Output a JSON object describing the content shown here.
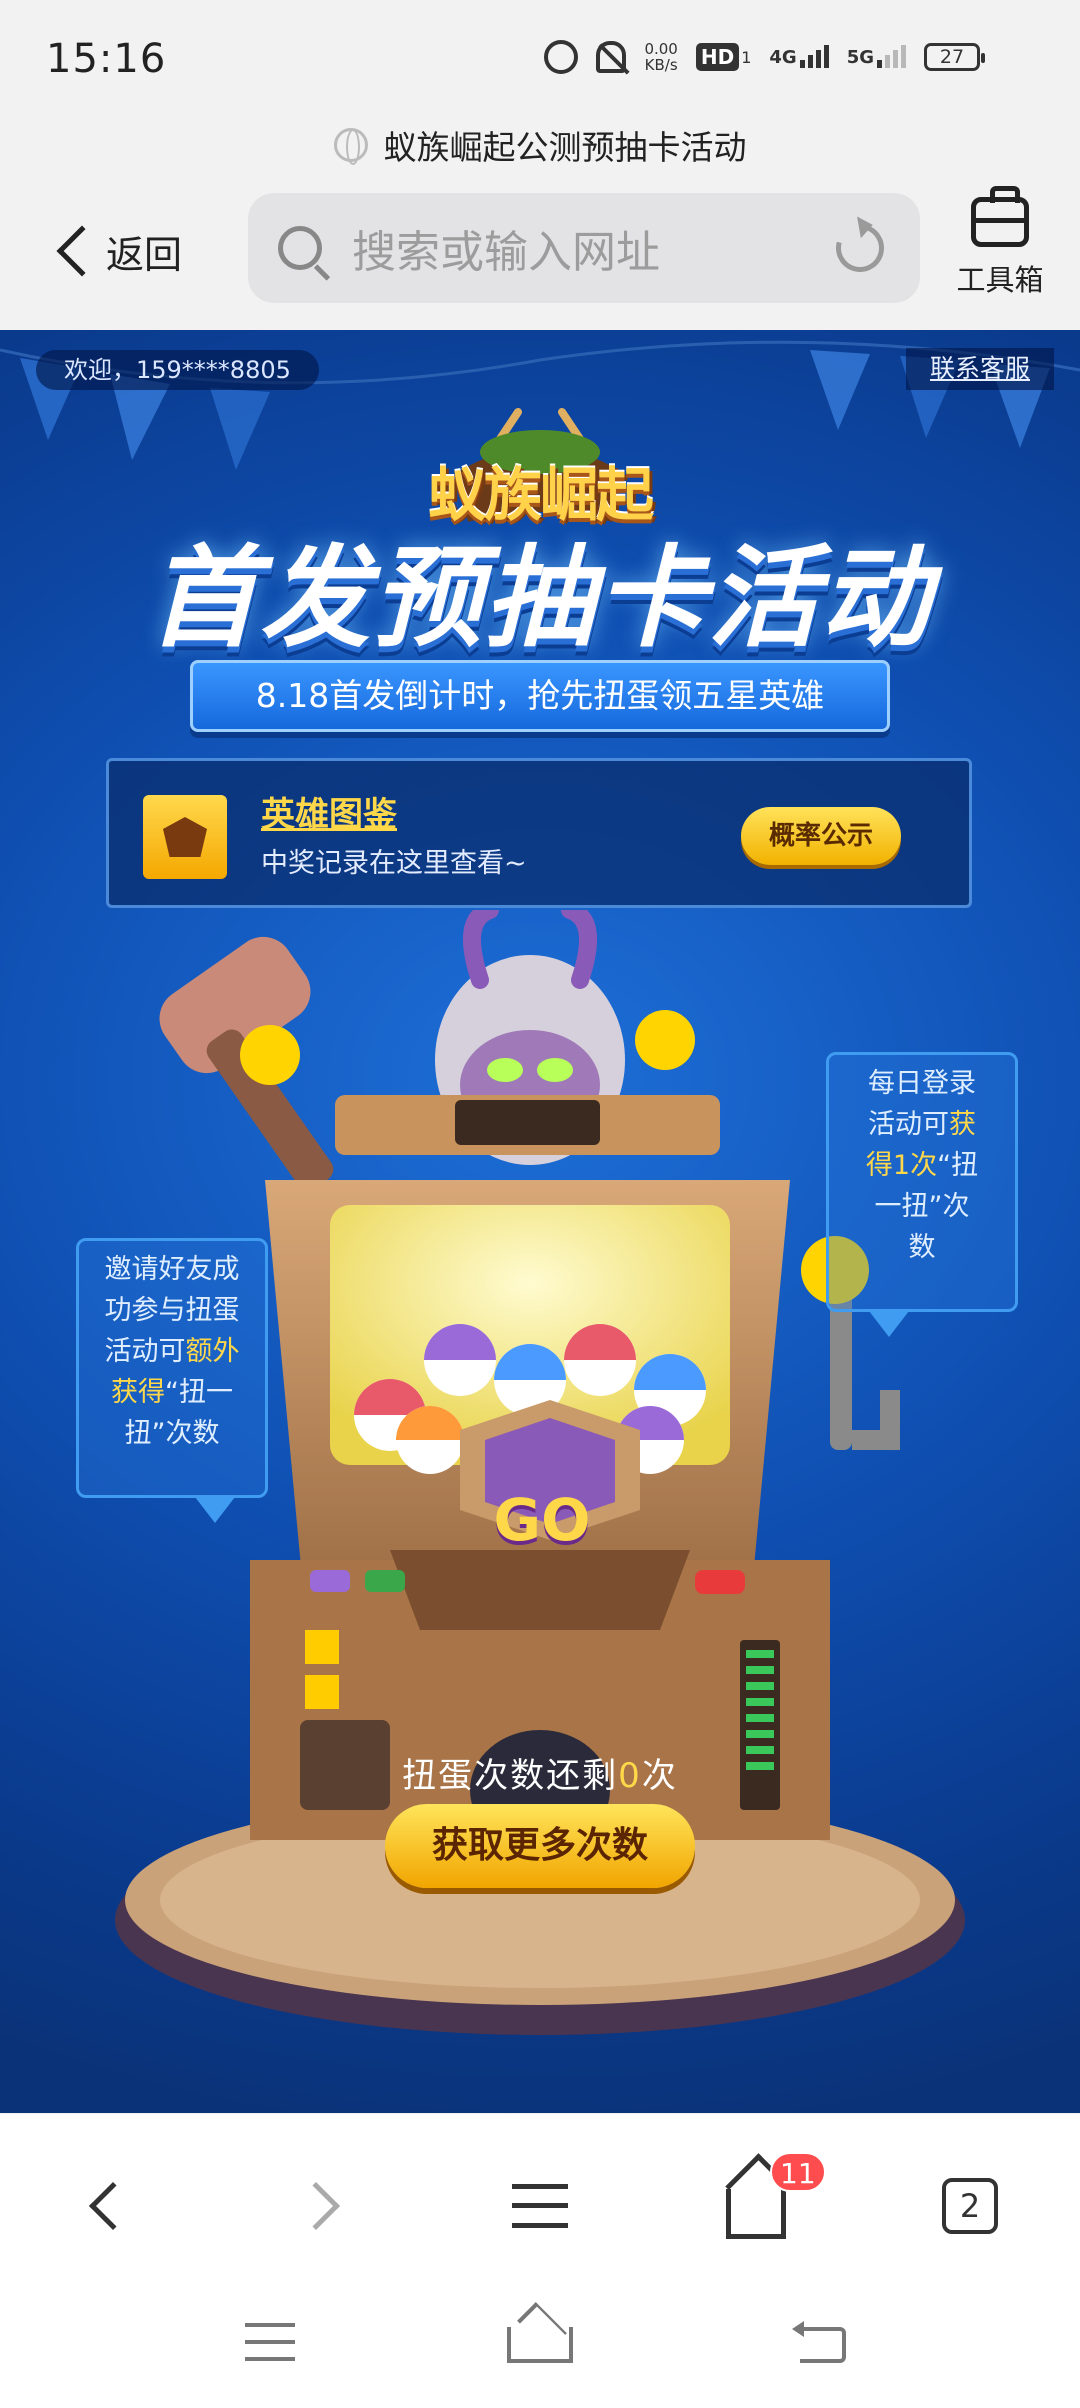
{
  "status_bar": {
    "time": "15:16",
    "net_speed_value": "0.00",
    "net_speed_unit": "KB/s",
    "hd_label": "HD",
    "hd_sub": "1",
    "net_4g": "4G",
    "net_5g": "5G",
    "battery": "27",
    "icons": [
      "alarm-icon",
      "bell-off-icon",
      "hd-icon",
      "signal-4g-icon",
      "signal-5g-icon",
      "battery-icon"
    ]
  },
  "browser": {
    "page_title": "蚁族崛起公测预抽卡活动",
    "back_label": "返回",
    "search_placeholder": "搜索或输入网址",
    "toolbox_label": "工具箱",
    "tab_count": "2",
    "home_badge": "11"
  },
  "page": {
    "welcome": "欢迎，159****8805",
    "service": "联系客服",
    "logo_text": "蚁族崛起",
    "headline": "首发预抽卡活动",
    "ribbon": "8.18首发倒计时，抢先扭蛋领五星英雄",
    "hero_title": "英雄图鉴",
    "hero_sub": "中奖记录在这里查看~",
    "prob_button": "概率公示",
    "bubble_right": {
      "l1": "每日登录",
      "l2a": "活动可",
      "l2b": "获",
      "l3a": "得1次",
      "l3b": "“扭",
      "l4": "一扭”次",
      "l5": "数"
    },
    "bubble_left": {
      "l1": "邀请好友成",
      "l2": "功参与扭蛋",
      "l3a": "活动可",
      "l3b": "额外",
      "l4a": "获得",
      "l4b": "“扭一",
      "l5": "扭”次数"
    },
    "go_label": "GO",
    "remain_prefix": "扭蛋次数还剩",
    "remain_count": "0",
    "remain_suffix": "次",
    "more_button": "获取更多次数"
  },
  "colors": {
    "accent_yellow": "#ffd84a",
    "bg_blue": "#1d6fd8",
    "badge_red": "#ff4d4f"
  }
}
